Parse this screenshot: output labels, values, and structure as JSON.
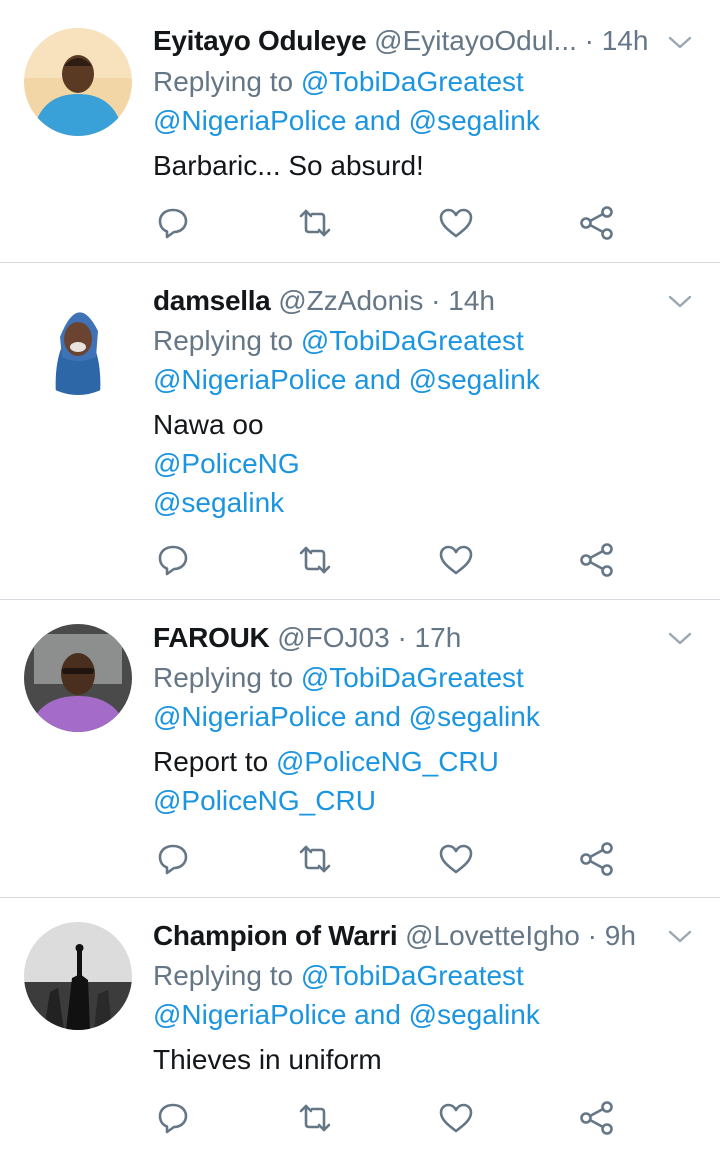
{
  "tweets": [
    {
      "name": "Eyitayo Oduleye",
      "handle": "@EyitayoOdul...",
      "dot": "·",
      "time": "14h",
      "reply_label": "Replying to",
      "reply_to_1": "@TobiDaGreatest",
      "reply_to_2": "@NigeriaPolice",
      "reply_and": "and",
      "reply_to_3": "@segalink",
      "text_1": "Barbaric... So absurd!"
    },
    {
      "name": "damsella",
      "handle": "@ZzAdonis",
      "dot": "·",
      "time": "14h",
      "reply_label": "Replying to",
      "reply_to_1": "@TobiDaGreatest",
      "reply_to_2": "@NigeriaPolice",
      "reply_and": "and",
      "reply_to_3": "@segalink",
      "text_1": "Nawa oo",
      "mention_1": "@PoliceNG",
      "mention_2": "@segalink"
    },
    {
      "name": "FAROUK",
      "handle": "@FOJ03",
      "dot": "·",
      "time": "17h",
      "reply_label": "Replying to",
      "reply_to_1": "@TobiDaGreatest",
      "reply_to_2": "@NigeriaPolice",
      "reply_and": "and",
      "reply_to_3": "@segalink",
      "text_1": "Report to",
      "text_1_mention": "@PoliceNG_CRU",
      "mention_1": "@PoliceNG_CRU"
    },
    {
      "name": "Champion of Warri",
      "handle": "@LovetteIgho",
      "dot": "·",
      "time": "9h",
      "reply_label": "Replying to",
      "reply_to_1": "@TobiDaGreatest",
      "reply_to_2": "@NigeriaPolice",
      "reply_and": "and",
      "reply_to_3": "@segalink",
      "text_1": "Thieves in uniform"
    }
  ],
  "icons": {
    "reply": "reply-icon",
    "retweet": "retweet-icon",
    "like": "like-icon",
    "share": "share-icon",
    "menu": "chevron-down-icon"
  },
  "colors": {
    "link": "#1b95e0",
    "muted": "#657786",
    "text": "#14171a",
    "divider": "#d7dbdf"
  }
}
